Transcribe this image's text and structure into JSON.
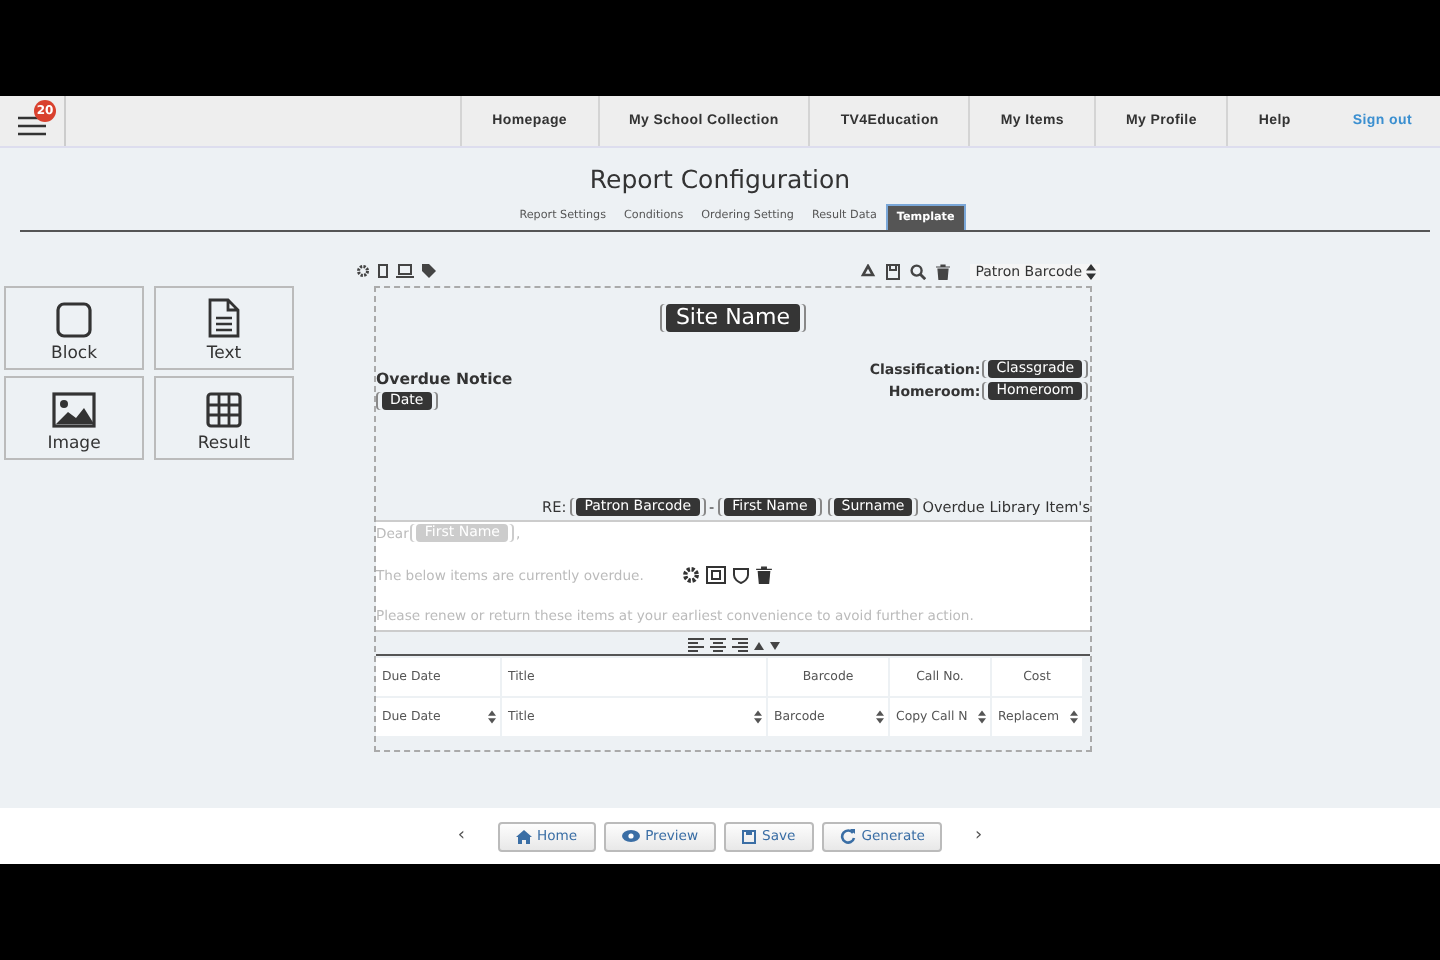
{
  "header": {
    "notification_count": "20",
    "nav": [
      {
        "label": "Homepage",
        "kind": "link"
      },
      {
        "label": "My School Collection",
        "kind": "link"
      },
      {
        "label": "TV4Education",
        "kind": "link"
      },
      {
        "label": "My Items",
        "kind": "link"
      },
      {
        "label": "My Profile",
        "kind": "link"
      },
      {
        "label": "Help",
        "kind": "link"
      },
      {
        "label": "Sign out",
        "kind": "signout"
      }
    ]
  },
  "page_title": "Report Configuration",
  "tabs": [
    {
      "label": "Report Settings",
      "selected": false
    },
    {
      "label": "Conditions",
      "selected": false
    },
    {
      "label": "Ordering Setting",
      "selected": false
    },
    {
      "label": "Result Data",
      "selected": false
    },
    {
      "label": "Template",
      "selected": true
    }
  ],
  "widgets": [
    {
      "label": "Block",
      "kind": "block"
    },
    {
      "label": "Text",
      "kind": "text"
    },
    {
      "label": "Image",
      "kind": "image"
    },
    {
      "label": "Result",
      "kind": "result"
    }
  ],
  "editor": {
    "field_select": "Patron Barcode",
    "site_name": "Site Name",
    "heading": "Overdue Notice",
    "date": "Date",
    "fields": [
      {
        "label": "Classification:",
        "tag": "Classgrade"
      },
      {
        "label": "Homeroom:",
        "tag": "Homeroom"
      }
    ],
    "re_line": {
      "prefix": "RE:",
      "tags": [
        "Patron Barcode",
        "First Name",
        "Surname"
      ],
      "separator": "-",
      "suffix": "Overdue Library Item's"
    },
    "text_block": {
      "greeting": "Dear",
      "greeting_tag": "First Name",
      "greeting_end": ",",
      "lines": [
        "The below items are currently overdue.",
        "Please renew or return these items at your earliest convenience to avoid further action."
      ]
    },
    "table": {
      "columns": [
        {
          "header": "Due Date",
          "select": "Due Date"
        },
        {
          "header": "Title",
          "select": "Title"
        },
        {
          "header": "Barcode",
          "select": "Barcode"
        },
        {
          "header": "Call No.",
          "select": "Copy Call N"
        },
        {
          "header": "Cost",
          "select": "Replacem"
        }
      ]
    }
  },
  "footer": {
    "prev": "‹",
    "next": "›",
    "buttons": [
      {
        "label": "Home",
        "kind": "home"
      },
      {
        "label": "Preview",
        "kind": "preview"
      },
      {
        "label": "Save",
        "kind": "save"
      },
      {
        "label": "Generate",
        "kind": "generate"
      }
    ]
  }
}
